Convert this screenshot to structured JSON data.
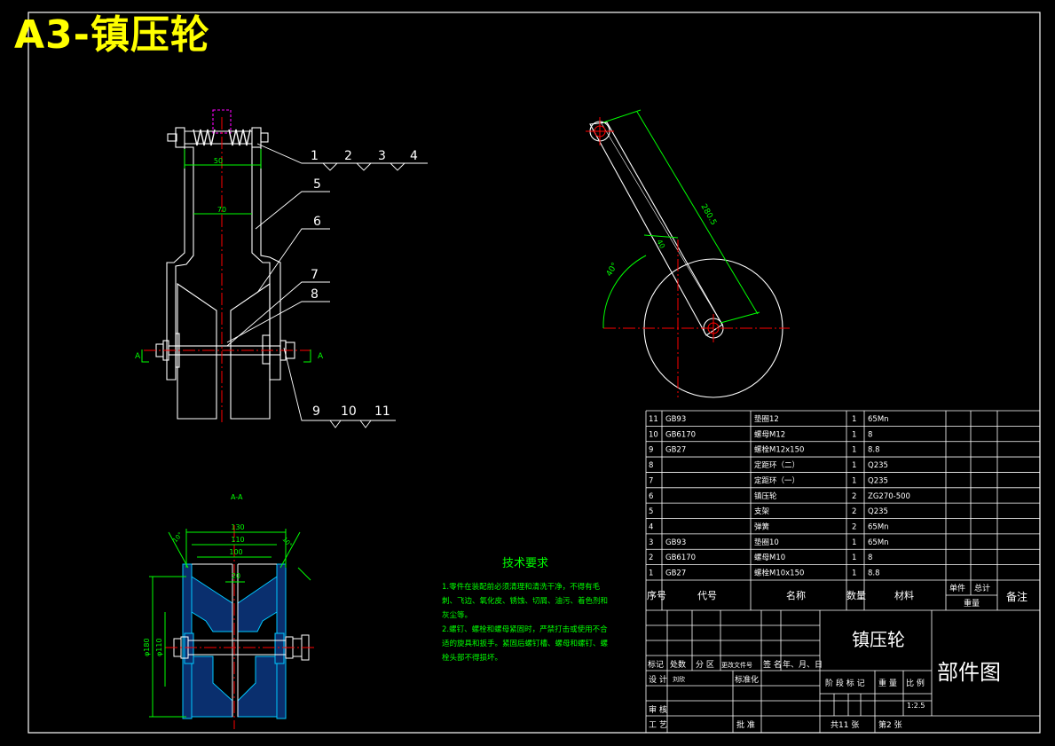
{
  "title": "A3-镇压轮",
  "colors": {
    "background": "#000000",
    "outline": "#ffffff",
    "dimension": "#00ff00",
    "centerline": "#ff0000",
    "hidden": "#ff00ff",
    "hatch": "#00c8ff",
    "title_text": "#ffff00",
    "frame": "#ffffff"
  },
  "front_view": {
    "dims": {
      "top_width": "50",
      "inner_width": "70"
    },
    "section_marks": [
      "A",
      "A"
    ],
    "balloons_top": [
      "1",
      "2",
      "3",
      "4"
    ],
    "balloons_side": [
      "5",
      "6",
      "7",
      "8"
    ],
    "balloons_bottom": [
      "9",
      "10",
      "11"
    ]
  },
  "side_view": {
    "arm_length": "280.5",
    "angle": "40°",
    "offset": "40"
  },
  "section_view": {
    "label": "A-A",
    "dims": {
      "overall": "130",
      "middle": "110",
      "inner": "100",
      "hub": "20",
      "dia_outer": "φ180",
      "dia_inner": "φ110",
      "chamfer_left": "10°",
      "chamfer_right": "10°"
    }
  },
  "tech_requirements": {
    "heading": "技术要求",
    "lines": [
      "1.零件在装配前必须清理和清洗干净，不得有毛",
      "刺、飞边、氧化皮、锈蚀、切屑、油污、着色剂和",
      "灰尘等。",
      "2.螺钉、螺栓和螺母紧固时，严禁打击或使用不合",
      "适的旋具和扳手。紧固后螺钉槽、螺母和螺钉、螺",
      "栓头部不得损坏。"
    ]
  },
  "bom": {
    "rows": [
      {
        "no": "11",
        "code": "GB93",
        "name": "垫圈12",
        "qty": "1",
        "mat": "65Mn"
      },
      {
        "no": "10",
        "code": "GB6170",
        "name": "螺母M12",
        "qty": "1",
        "mat": "8"
      },
      {
        "no": "9",
        "code": "GB27",
        "name": "螺栓M12x150",
        "qty": "1",
        "mat": "8.8"
      },
      {
        "no": "8",
        "code": "",
        "name": "定距环（二）",
        "qty": "1",
        "mat": "Q235"
      },
      {
        "no": "7",
        "code": "",
        "name": "定距环（一）",
        "qty": "1",
        "mat": "Q235"
      },
      {
        "no": "6",
        "code": "",
        "name": "镇压轮",
        "qty": "2",
        "mat": "ZG270-500"
      },
      {
        "no": "5",
        "code": "",
        "name": "支架",
        "qty": "2",
        "mat": "Q235"
      },
      {
        "no": "4",
        "code": "",
        "name": "弹簧",
        "qty": "2",
        "mat": "65Mn"
      },
      {
        "no": "3",
        "code": "GB93",
        "name": "垫圈10",
        "qty": "1",
        "mat": "65Mn"
      },
      {
        "no": "2",
        "code": "GB6170",
        "name": "螺母M10",
        "qty": "1",
        "mat": "8"
      },
      {
        "no": "1",
        "code": "GB27",
        "name": "螺栓M10x150",
        "qty": "1",
        "mat": "8.8"
      }
    ],
    "header": {
      "no": "序号",
      "code": "代号",
      "name": "名称",
      "qty": "数量",
      "mat": "材料",
      "unit": "单件",
      "total": "总计",
      "weight": "重量",
      "remark": "备注"
    }
  },
  "title_block": {
    "part_name": "镇压轮",
    "drawing_type": "部件图",
    "rev_headers": [
      "标记",
      "处数",
      "分 区",
      "更改文件号",
      "签 名",
      "年、月、日"
    ],
    "design_label": "设 计",
    "design_sig": "刘欣",
    "standard_label": "标准化",
    "review_label": "审 核",
    "process_label": "工 艺",
    "approve_label": "批 准",
    "stage_label": "阶 段 标 记",
    "weight_label": "重 量",
    "scale_label": "比 例",
    "scale_value": "1:2.5",
    "sheets_total": "共11 张",
    "sheet_no": "第2 张"
  }
}
